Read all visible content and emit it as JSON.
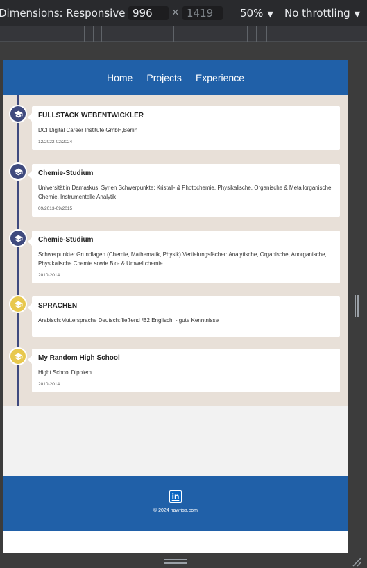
{
  "devtools": {
    "dimensions_label": "Dimensions: Responsive",
    "width": "996",
    "height_placeholder": "1419",
    "times": "×",
    "zoom": "50%",
    "throttling": "No throttling"
  },
  "nav": {
    "items": [
      {
        "label": "Home"
      },
      {
        "label": "Projects"
      },
      {
        "label": "Experience"
      }
    ]
  },
  "timeline": [
    {
      "title": "FULLSTACK WEBENTWICKLER",
      "desc": "DCI Digital Career Institute GmbH,Berlin",
      "date": "12/2022-02/2024",
      "icon": "graduation-cap-icon",
      "color": "#3f4a7e"
    },
    {
      "title": "Chemie-Studium",
      "desc": "Universität in Damaskus, Syrien Schwerpunkte: Kristall- & Photochemie, Physikalische, Organische & Metallorganische Chemie, Instrumentelle Analytik",
      "date": "09/2013-09/2015",
      "icon": "graduation-cap-icon",
      "color": "#3f4a7e"
    },
    {
      "title": "Chemie-Studium",
      "desc": "Schwerpunkte: Grundlagen (Chemie, Mathematik, Physik) Vertiefungsfächer: Analytische, Organische, Anorganische, Physikalische Chemie sowie Bio- & Umweltchemie",
      "date": "2010-2014",
      "icon": "graduation-cap-icon",
      "color": "#3f4a7e"
    },
    {
      "title": "SPRACHEN",
      "desc": "Arabisch:Muttersprache Deutsch:fließend /B2 Englisch: - gute Kenntnisse",
      "date": "",
      "icon": "graduation-cap-icon",
      "color": "#e8c84e"
    },
    {
      "title": "My Random High School",
      "desc": "Hight School Dipolem",
      "date": "2010-2014",
      "icon": "graduation-cap-icon",
      "color": "#e8c84e"
    }
  ],
  "footer": {
    "linkedin_label": "in",
    "copyright": "© 2024 nawrisa.com"
  },
  "colors": {
    "nav_bg": "#2060a8",
    "timeline_bg": "#e8e0d8",
    "timeline_line": "#3f4a7e",
    "accent_gold": "#e8c84e"
  }
}
